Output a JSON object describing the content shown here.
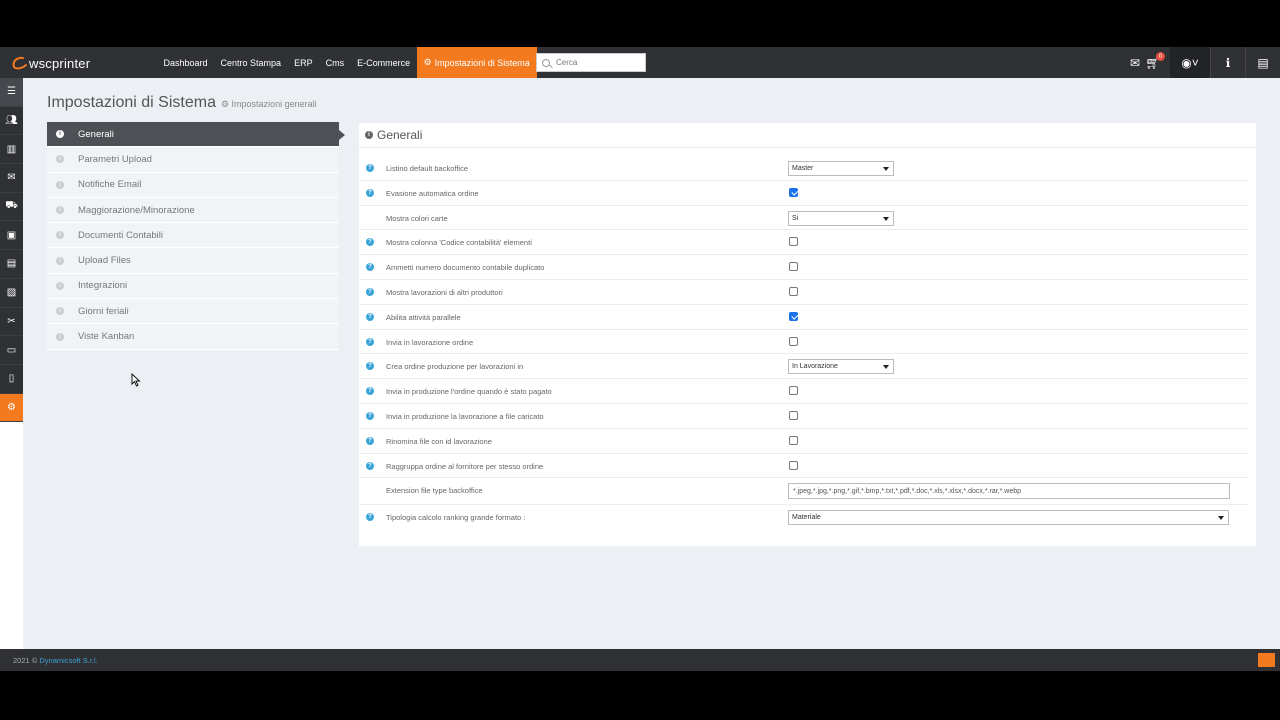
{
  "app": {
    "logo_text": "wscprinter",
    "brand_color": "#f47a20"
  },
  "nav": {
    "items": [
      "Dashboard",
      "Centro Stampa",
      "ERP",
      "Cms",
      "E-Commerce"
    ],
    "active_item": "Impostazioni di Sistema",
    "search_placeholder": "Cerca",
    "notification_count": "0"
  },
  "page": {
    "title": "Impostazioni di Sistema",
    "subtitle": "Impostazioni generali"
  },
  "settings_menu": [
    "Generali",
    "Parametri Upload",
    "Notifiche Email",
    "Maggiorazione/Minorazione",
    "Documenti Contabili",
    "Upload Files",
    "Integrazioni",
    "Giorni feriali",
    "Viste Kanban"
  ],
  "panel": {
    "title": "Generali",
    "rows": [
      {
        "label": "Listino default backoffice",
        "help": true,
        "control": "select",
        "value": "Master"
      },
      {
        "label": "Evasione automatica ordine",
        "help": true,
        "control": "checkbox",
        "checked": true
      },
      {
        "label": "Mostra colori carte",
        "help": false,
        "control": "select",
        "value": "Si"
      },
      {
        "label": "Mostra colonna 'Codice contabilità' elementi",
        "help": true,
        "control": "checkbox",
        "checked": false
      },
      {
        "label": "Ammetti numero documento contabile duplicato",
        "help": true,
        "control": "checkbox",
        "checked": false
      },
      {
        "label": "Mostra lavorazioni di altri produttori",
        "help": true,
        "control": "checkbox",
        "checked": false
      },
      {
        "label": "Abilita attività parallele",
        "help": true,
        "control": "checkbox",
        "checked": true
      },
      {
        "label": "Invia in lavorazione ordine",
        "help": true,
        "control": "checkbox",
        "checked": false
      },
      {
        "label": "Crea ordine produzione per lavorazioni in",
        "help": true,
        "control": "select",
        "value": "In Lavorazione"
      },
      {
        "label": "Invia in produzione l'ordine quando è stato pagato",
        "help": true,
        "control": "checkbox",
        "checked": false
      },
      {
        "label": "Invia in produzione la lavorazione a file caricato",
        "help": true,
        "control": "checkbox",
        "checked": false
      },
      {
        "label": "Rinomina file con id lavorazione",
        "help": true,
        "control": "checkbox",
        "checked": false
      },
      {
        "label": "Raggruppa ordine al fornitore per stesso ordine",
        "help": true,
        "control": "checkbox",
        "checked": false
      },
      {
        "label": "Extension file type backoffice",
        "help": false,
        "control": "text",
        "value": "*.jpeg,*.jpg,*.png,*.gif,*.bmp,*.txt,*.pdf,*.doc,*.xls,*.xlsx,*.docx,*.rar,*.webp"
      },
      {
        "label": "Tipologia calcolo ranking grande formato :",
        "help": true,
        "control": "select-wide",
        "value": "Materiale"
      }
    ]
  },
  "footer": {
    "year": "2021 ©",
    "company": "Dynamicsoft S.r.l."
  }
}
